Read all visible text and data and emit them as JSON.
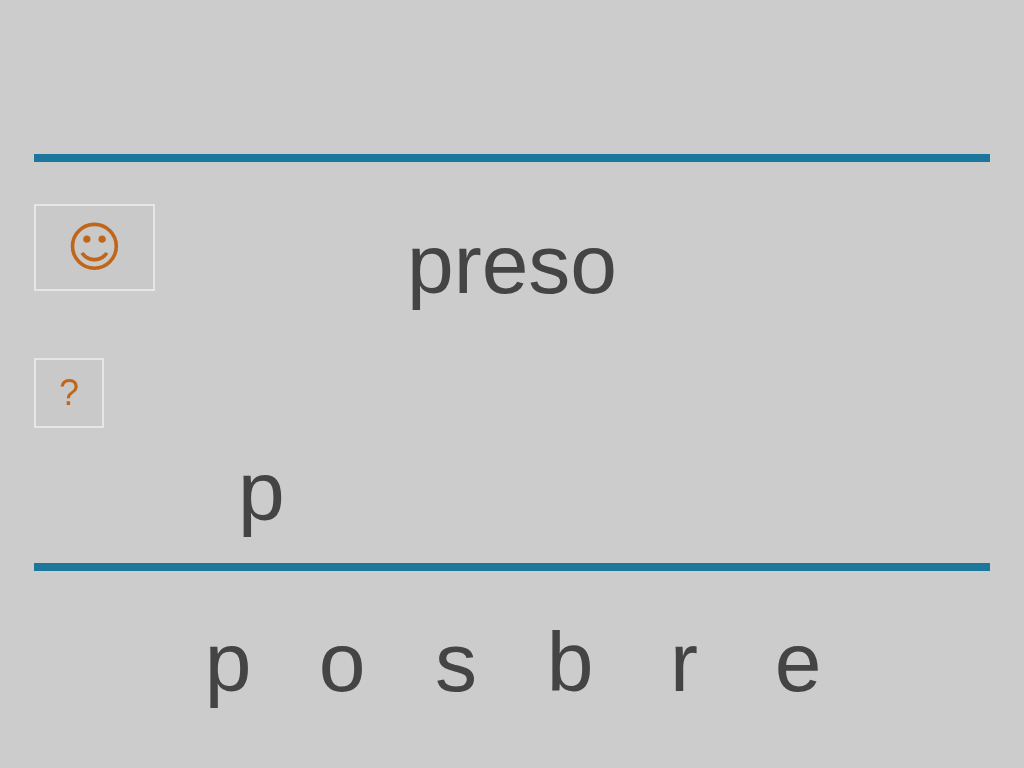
{
  "prompt_word": "preso",
  "hint_button": {
    "label": "☺"
  },
  "help_button": {
    "label": "?"
  },
  "answer": "p",
  "letters": [
    "p",
    "o",
    "s",
    "b",
    "r",
    "e"
  ]
}
